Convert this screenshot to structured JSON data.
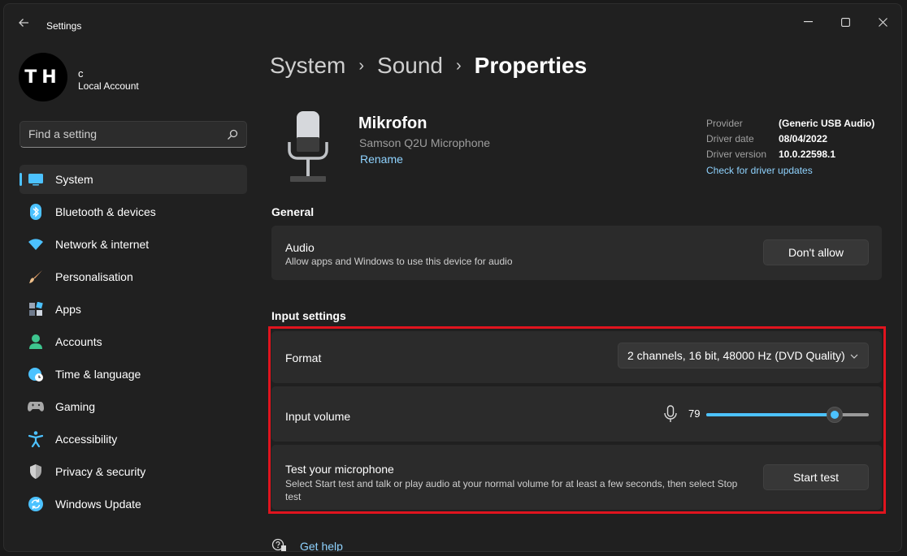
{
  "window": {
    "app_title": "Settings",
    "back_icon": "back-arrow-icon",
    "controls": [
      "minimize-icon",
      "maximize-icon",
      "close-icon"
    ]
  },
  "user": {
    "avatar_initials": "TH",
    "name": "c",
    "account_type": "Local Account"
  },
  "search": {
    "placeholder": "Find a setting",
    "icon": "search-icon"
  },
  "nav": {
    "items": [
      {
        "label": "System",
        "icon": "system-display-icon",
        "active": true,
        "color": "#4cc2ff"
      },
      {
        "label": "Bluetooth & devices",
        "icon": "bluetooth-icon",
        "color": "#4cc2ff"
      },
      {
        "label": "Network & internet",
        "icon": "wifi-icon",
        "color": "#4cc2ff"
      },
      {
        "label": "Personalisation",
        "icon": "brush-icon",
        "color": "#e8a36a"
      },
      {
        "label": "Apps",
        "icon": "apps-icon",
        "color": "#9aa4b5"
      },
      {
        "label": "Accounts",
        "icon": "person-icon",
        "color": "#3ec58f"
      },
      {
        "label": "Time & language",
        "icon": "globe-clock-icon",
        "color": "#4cc2ff"
      },
      {
        "label": "Gaming",
        "icon": "gamepad-icon",
        "color": "#a8a8a8"
      },
      {
        "label": "Accessibility",
        "icon": "accessibility-icon",
        "color": "#4cc2ff"
      },
      {
        "label": "Privacy & security",
        "icon": "shield-icon",
        "color": "#a8a8a8"
      },
      {
        "label": "Windows Update",
        "icon": "update-icon",
        "color": "#4cc2ff"
      }
    ]
  },
  "breadcrumb": {
    "items": [
      "System",
      "Sound",
      "Properties"
    ]
  },
  "device": {
    "name": "Mikrofon",
    "model": "Samson Q2U Microphone",
    "rename_label": "Rename",
    "image_icon": "microphone-device-icon"
  },
  "driver": {
    "rows": [
      {
        "label": "Provider",
        "value": "(Generic USB Audio)"
      },
      {
        "label": "Driver date",
        "value": "08/04/2022"
      },
      {
        "label": "Driver version",
        "value": "10.0.22598.1"
      }
    ],
    "update_link": "Check for driver updates"
  },
  "general": {
    "section_title": "General",
    "audio": {
      "title": "Audio",
      "description": "Allow apps and Windows to use this device for audio",
      "button_label": "Don't allow"
    }
  },
  "input_settings": {
    "section_title": "Input settings",
    "format": {
      "title": "Format",
      "selected": "2 channels, 16 bit, 48000 Hz (DVD Quality)"
    },
    "volume": {
      "title": "Input volume",
      "value": "79",
      "level": 0.79
    },
    "test": {
      "title": "Test your microphone",
      "description": "Select Start test and talk or play audio at your normal volume for at least a few seconds, then select Stop test",
      "button_label": "Start test"
    }
  },
  "help": {
    "label": "Get help",
    "icon": "help-chat-icon"
  },
  "colors": {
    "accent": "#4cc2ff",
    "link": "#8fd3ff",
    "highlight": "#e0141e"
  }
}
